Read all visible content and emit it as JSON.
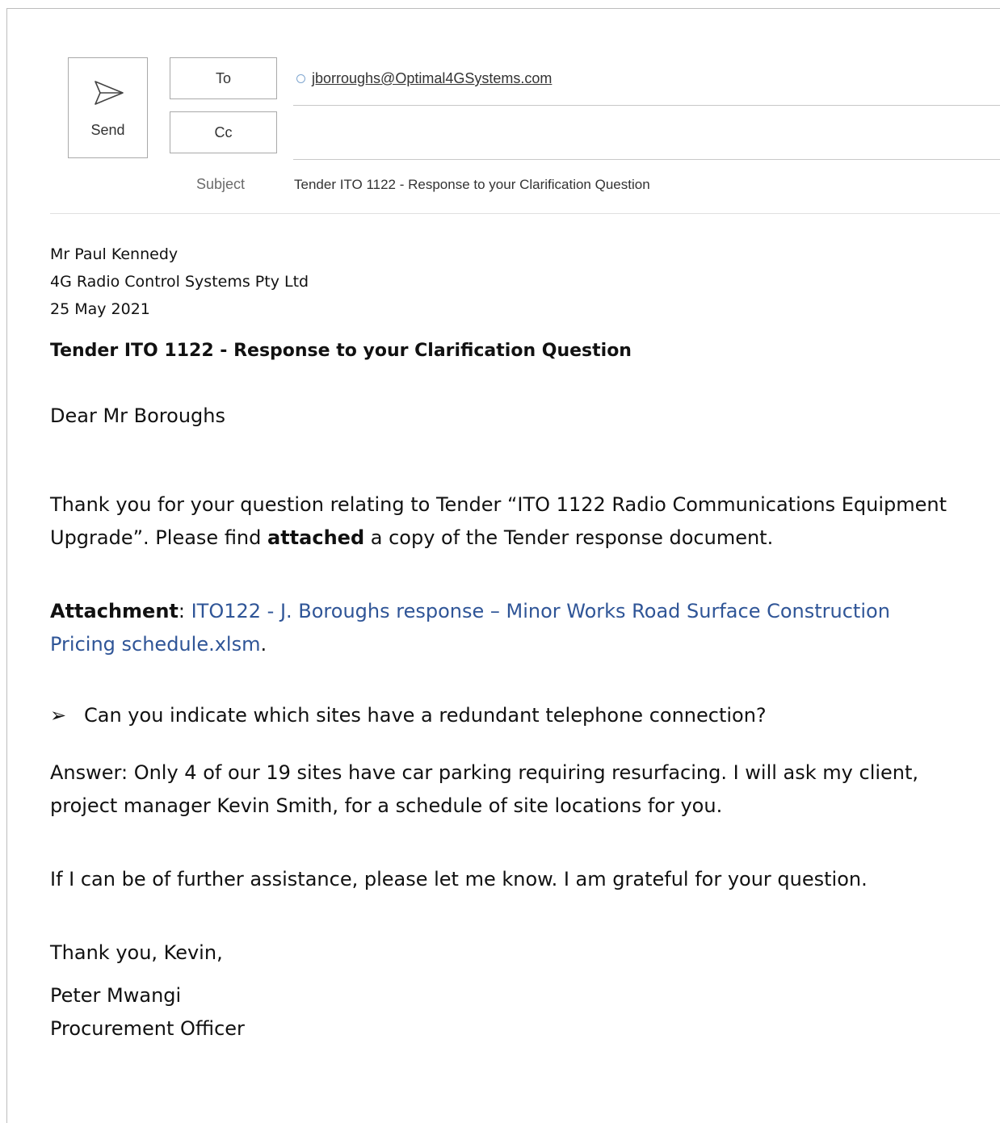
{
  "compose": {
    "send_label": "Send",
    "to_label": "To",
    "cc_label": "Cc",
    "to_recipient": "jborroughs@Optimal4GSystems.com",
    "cc_value": "",
    "subject_label": "Subject",
    "subject_value": "Tender ITO 1122 - Response to your Clarification Question"
  },
  "body": {
    "sender_name": "Mr Paul Kennedy",
    "sender_company": "4G Radio Control Systems Pty Ltd",
    "date": "25 May 2021",
    "heading": "Tender ITO 1122 - Response to your Clarification Question",
    "greeting": "Dear Mr Boroughs",
    "intro_part1": "Thank you for your question relating to Tender “ITO 1122 Radio Communications Equipment Upgrade”. Please find ",
    "intro_bold": "attached",
    "intro_part2": " a copy of the Tender response document.",
    "attachment_label": "Attachment",
    "attachment_colon": ": ",
    "attachment_name": "ITO122 - J. Boroughs response – Minor Works Road Surface Construction Pricing schedule.xlsm",
    "attachment_period": ".",
    "bullet_symbol": "➢",
    "question": "Can you indicate which sites have a redundant telephone connection?",
    "answer": "Answer: Only 4 of our 19 sites have car parking requiring resurfacing. I will ask my client, project manager Kevin Smith, for a schedule of site locations for you.",
    "closing_line": "If I can be of further assistance, please let me know. I am grateful for your question.",
    "thanks": "Thank you, Kevin,",
    "signature_name": "Peter Mwangi",
    "signature_title": "Procurement Officer"
  }
}
